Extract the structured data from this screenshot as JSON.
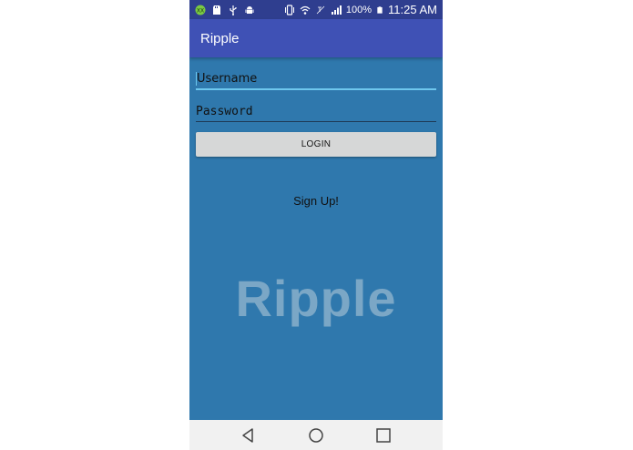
{
  "status_bar": {
    "notification_icons": [
      "app-notification-icon",
      "sd-card-icon",
      "usb-icon",
      "android-debug-icon"
    ],
    "battery": "100%",
    "time": "11:25 AM"
  },
  "app_bar": {
    "title": "Ripple"
  },
  "form": {
    "username_placeholder": "Username",
    "password_placeholder": "Password",
    "login_label": "LOGIN",
    "signup_label": "Sign Up!"
  },
  "watermark": "Ripple",
  "nav_bar": {
    "buttons": [
      "back-icon",
      "home-icon",
      "recents-icon"
    ]
  },
  "colors": {
    "status_bar": "#2f3e8f",
    "app_bar": "#3f51b5",
    "background": "#2f78ad",
    "accent": "#6ec7ee",
    "button": "#d6d7d7"
  }
}
